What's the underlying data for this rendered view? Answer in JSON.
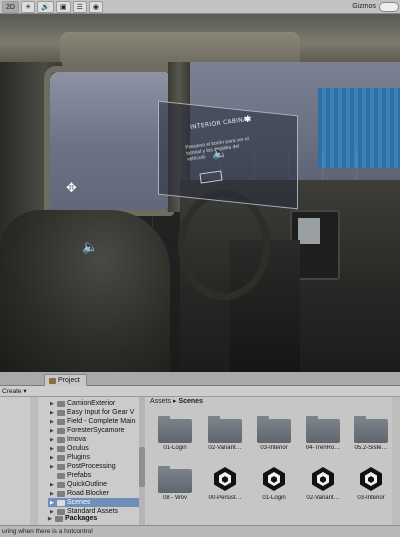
{
  "scene": {
    "toolbar": {
      "mode_2d": "2D",
      "gizmos_label": "Gizmos"
    },
    "overlay_panel": {
      "title": "INTERIOR CABINA",
      "text": "Presiona el botón para ver el tutorial y los detalles del vehículo"
    },
    "icons": [
      "speaker-icon",
      "move-icon",
      "sun-icon",
      "audio-icon",
      "light-icon"
    ]
  },
  "project": {
    "tab_label": "Project",
    "create_label": "Create",
    "tree": {
      "items": [
        {
          "label": "CamionExterior"
        },
        {
          "label": "Easy Input for Gear V"
        },
        {
          "label": "Field - Complete Main"
        },
        {
          "label": "ForesterSycamore"
        },
        {
          "label": "Imova"
        },
        {
          "label": "Oculus"
        },
        {
          "label": "Plugins"
        },
        {
          "label": "PostProcessing"
        },
        {
          "label": "Prefabs"
        },
        {
          "label": "QuickOutline"
        },
        {
          "label": "Road Blocker"
        },
        {
          "label": "Scenes",
          "selected": true
        },
        {
          "label": "Standard Assets"
        }
      ],
      "packages_label": "Packages"
    },
    "breadcrumb": {
      "root": "Assets",
      "separator": "▸",
      "current": "Scenes"
    },
    "assets": [
      {
        "label": "01-Login",
        "kind": "folder"
      },
      {
        "label": "02-Variant…",
        "kind": "folder"
      },
      {
        "label": "03-Interior",
        "kind": "folder"
      },
      {
        "label": "04-TrenRo…",
        "kind": "folder"
      },
      {
        "label": "05.2-Siste…",
        "kind": "folder"
      },
      {
        "label": "08 - Wov",
        "kind": "folder"
      },
      {
        "label": "00-Persist…",
        "kind": "scene"
      },
      {
        "label": "01-Login",
        "kind": "scene"
      },
      {
        "label": "02-Variant…",
        "kind": "scene"
      },
      {
        "label": "03-Interior",
        "kind": "scene"
      }
    ],
    "status_text": "uring when there is a hotcontrol"
  }
}
